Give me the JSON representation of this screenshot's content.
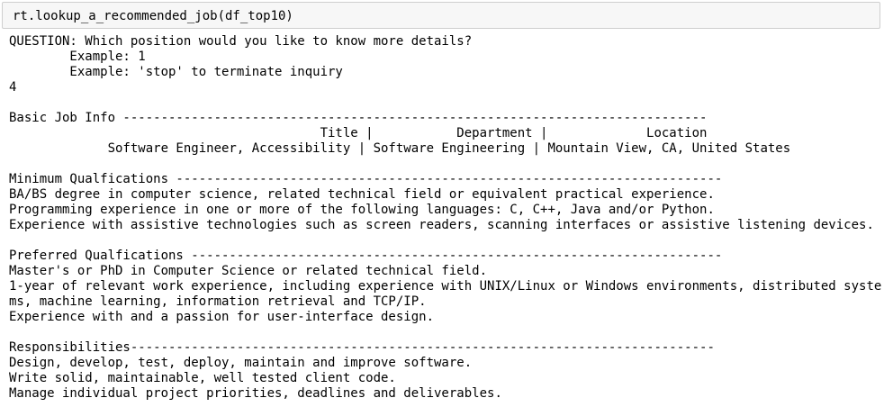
{
  "input_cell": {
    "code": "rt.lookup_a_recommended_job(df_top10)"
  },
  "output_lines": [
    "QUESTION: Which position would you like to know more details?",
    "        Example: 1",
    "        Example: 'stop' to terminate inquiry",
    "4",
    "",
    "Basic Job Info -----------------------------------------------------------------------------",
    "                                         Title |           Department |             Location",
    "             Software Engineer, Accessibility | Software Engineering | Mountain View, CA, United States",
    "",
    "Minimum Qualfications ------------------------------------------------------------------------",
    "BA/BS degree in computer science, related technical field or equivalent practical experience.",
    "Programming experience in one or more of the following languages: C, C++, Java and/or Python.",
    "Experience with assistive technologies such as screen readers, scanning interfaces or assistive listening devices.",
    "",
    "Preferred Qualfications ----------------------------------------------------------------------",
    "Master's or PhD in Computer Science or related technical field.",
    "1-year of relevant work experience, including experience with UNIX/Linux or Windows environments, distributed syste",
    "ms, machine learning, information retrieval and TCP/IP.",
    "Experience with and a passion for user-interface design.",
    "",
    "Responsibilities-----------------------------------------------------------------------------",
    "Design, develop, test, deploy, maintain and improve software.",
    "Write solid, maintainable, well tested client code.",
    "Manage individual project priorities, deadlines and deliverables."
  ]
}
